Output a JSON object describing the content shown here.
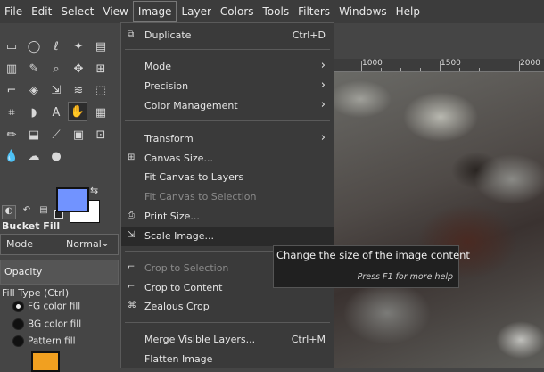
{
  "menubar": {
    "items": [
      "File",
      "Edit",
      "Select",
      "View",
      "Image",
      "Layer",
      "Colors",
      "Tools",
      "Filters",
      "Windows",
      "Help"
    ],
    "active": "Image"
  },
  "image_menu": {
    "items": [
      {
        "label": "Duplicate",
        "shortcut": "Ctrl+D",
        "icon": "duplicate-icon"
      },
      {
        "label": "Mode",
        "submenu": true
      },
      {
        "label": "Precision",
        "submenu": true
      },
      {
        "label": "Color Management",
        "submenu": true
      },
      {
        "label": "Transform",
        "submenu": true
      },
      {
        "label": "Canvas Size...",
        "icon": "canvas-size-icon"
      },
      {
        "label": "Fit Canvas to Layers"
      },
      {
        "label": "Fit Canvas to Selection",
        "disabled": true
      },
      {
        "label": "Print Size...",
        "icon": "print-icon"
      },
      {
        "label": "Scale Image...",
        "icon": "scale-icon",
        "highlighted": true
      },
      {
        "label": "Crop to Selection",
        "disabled": true,
        "icon": "crop-icon"
      },
      {
        "label": "Crop to Content",
        "icon": "crop-icon"
      },
      {
        "label": "Zealous Crop",
        "icon": "zealous-crop-icon"
      },
      {
        "label": "Merge Visible Layers...",
        "shortcut": "Ctrl+M"
      },
      {
        "label": "Flatten Image"
      }
    ]
  },
  "tooltip": {
    "main": "Change the size of the image content",
    "hint": "Press F1 for more help"
  },
  "ruler": {
    "labels": [
      "1000",
      "1500",
      "2000"
    ]
  },
  "colors": {
    "foreground": "#7193ff",
    "background": "#ffffff"
  },
  "tool_options": {
    "title": "Bucket Fill",
    "mode_label": "Mode",
    "mode_value": "Normal",
    "opacity_label": "Opacity",
    "fill_type_label": "Fill Type  (Ctrl)",
    "fill_options": [
      "FG color fill",
      "BG color fill",
      "Pattern fill"
    ],
    "selected_fill": "FG color fill"
  }
}
